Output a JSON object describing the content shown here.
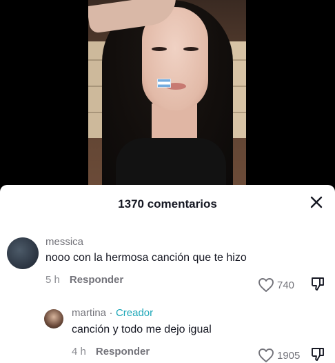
{
  "sheet": {
    "title": "1370 comentarios"
  },
  "comments": [
    {
      "username": "messica",
      "text": "nooo con la hermosa canción que te hizo",
      "time": "5 h",
      "reply_label": "Responder",
      "likes": "740"
    },
    {
      "username": "martina",
      "separator": "·",
      "badge": "Creador",
      "text": "canción y todo me dejo igual",
      "time": "4 h",
      "reply_label": "Responder",
      "likes": "1905"
    }
  ],
  "icons": {
    "close": "close-icon",
    "like": "heart-icon",
    "dislike": "thumbs-down-icon",
    "flag": "argentina-flag"
  },
  "colors": {
    "creator_badge": "#1ea7b8",
    "text_primary": "#161823",
    "text_secondary": "#73737a"
  }
}
